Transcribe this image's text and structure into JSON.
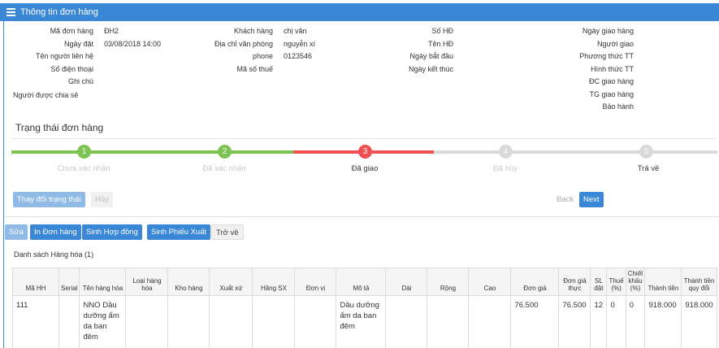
{
  "header": {
    "title": "Thông tin đơn hàng"
  },
  "info": {
    "col1": [
      {
        "label": "Mã đơn hàng",
        "value": "ĐH2"
      },
      {
        "label": "Ngày đặt",
        "value": "03/08/2018 14:00"
      },
      {
        "label": "Tên người liên hệ",
        "value": ""
      },
      {
        "label": "Số điện thoại",
        "value": ""
      },
      {
        "label": "Ghi chú",
        "value": ""
      }
    ],
    "col1_extra_label": "Người được chia sẻ",
    "col2": [
      {
        "label": "Khách hàng",
        "value": "chị vân"
      },
      {
        "label": "Địa chỉ văn phòng",
        "value": "nguyễn xí"
      },
      {
        "label": "phone",
        "value": "0123546"
      },
      {
        "label": "Mã số thuế",
        "value": ""
      }
    ],
    "col3": [
      {
        "label": "Số HĐ",
        "value": ""
      },
      {
        "label": "Tên HĐ",
        "value": ""
      },
      {
        "label": "Ngày bắt đầu",
        "value": ""
      },
      {
        "label": "Ngày kết thúc",
        "value": ""
      }
    ],
    "col4": [
      {
        "label": "Ngày giao hàng",
        "value": ""
      },
      {
        "label": "Người giao",
        "value": ""
      },
      {
        "label": "Phương thức TT",
        "value": ""
      },
      {
        "label": "Hình thức TT",
        "value": ""
      },
      {
        "label": "ĐC giao hàng",
        "value": ""
      },
      {
        "label": "TG giao hàng",
        "value": ""
      },
      {
        "label": "Bảo hành",
        "value": ""
      }
    ]
  },
  "status": {
    "title": "Trạng thái đơn hàng",
    "steps": [
      {
        "num": "1",
        "label": "Chưa xác nhận"
      },
      {
        "num": "2",
        "label": "Đã xác nhận"
      },
      {
        "num": "3",
        "label": "Đã giao"
      },
      {
        "num": "4",
        "label": "Đã hủy"
      },
      {
        "num": "5",
        "label": "Trả về"
      }
    ],
    "colors": {
      "done": "#7cc352",
      "current": "#f05050",
      "todo": "#d9d9d9"
    },
    "change_status_label": "Thay đổi trạng thái",
    "cancel_label": "Hủy",
    "back_label": "Back",
    "next_label": "Next"
  },
  "actions": {
    "edit": "Sửa",
    "print": "In Đơn hàng",
    "contract": "Sinh Hợp đồng",
    "export": "Sinh Phiếu Xuất",
    "back": "Trở về"
  },
  "goods": {
    "title": "Danh sách Hàng hóa (1)",
    "headers": [
      "Mã HH",
      "Serial",
      "Tên hàng hóa",
      "Loại hàng hóa",
      "Kho hàng",
      "Xuất xứ",
      "Hãng SX",
      "Đơn vị",
      "Mô tả",
      "Dài",
      "Rộng",
      "Cao",
      "Đơn giá",
      "Đơn giá thực",
      "SL đặt",
      "Thuế (%)",
      "Chiết khấu (%)",
      "Thành tiền",
      "Thành tiền quy đổi"
    ],
    "rows": [
      [
        "111",
        "",
        "NNO Dầu dưỡng ẩm da ban đêm",
        "",
        "",
        "",
        "",
        "",
        "Dầu dưỡng ẩm da ban đêm",
        "",
        "",
        "",
        "76.500",
        "76.500",
        "12",
        "0",
        "0",
        "918.000",
        "918.000"
      ]
    ]
  },
  "accent": "#3a87d5"
}
